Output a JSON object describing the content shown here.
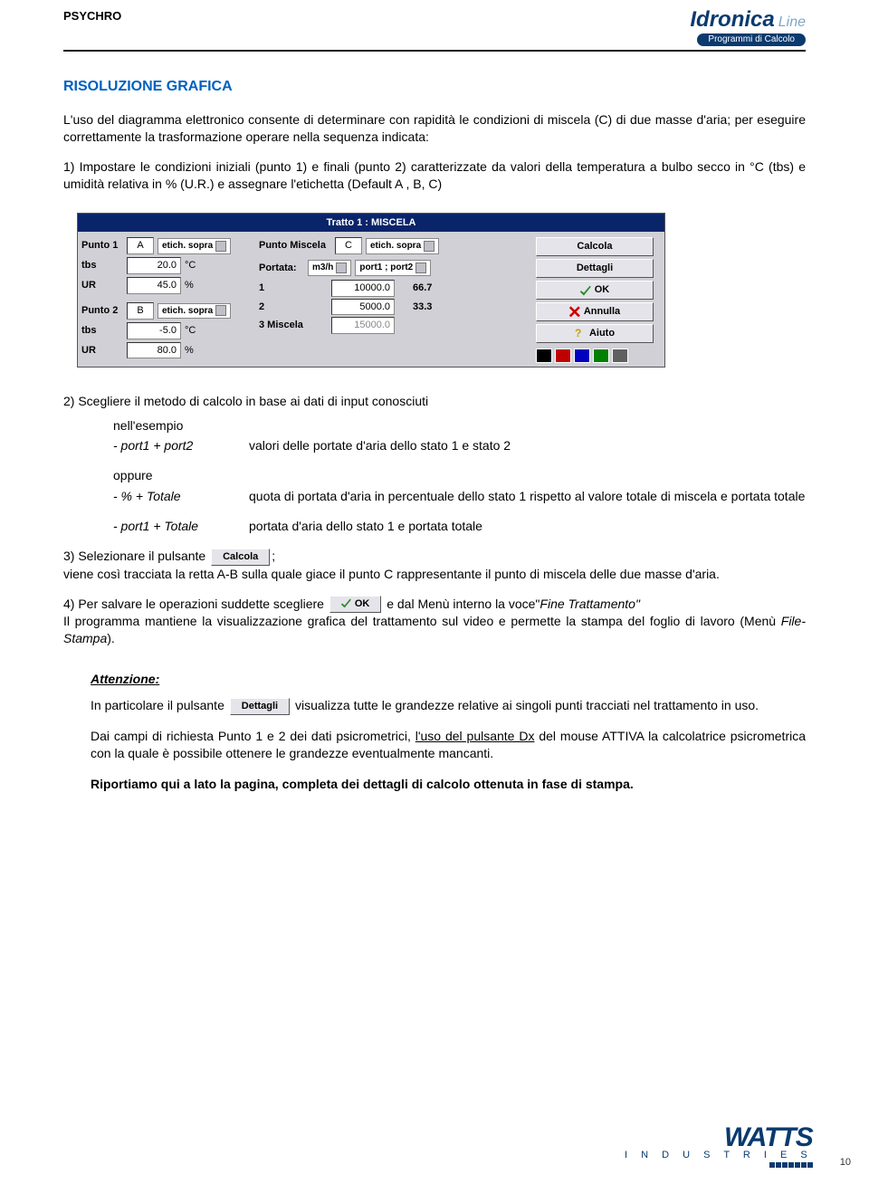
{
  "header": {
    "left": "PSYCHRO",
    "logo_main": "Idronica",
    "logo_sub": "Line",
    "logo_tag": "Programmi di Calcolo"
  },
  "title": "RISOLUZIONE GRAFICA",
  "intro": "L'uso del diagramma elettronico consente di determinare con rapidità le condizioni di miscela (C) di due masse d'aria; per eseguire correttamente la trasformazione operare nella sequenza indicata:",
  "step1": "1) Impostare le condizioni iniziali (punto 1) e finali (punto 2) caratterizzate da valori della temperatura a bulbo secco in °C (tbs) e umidità relativa in % (U.R.) e assegnare l'etichetta (Default A , B, C)",
  "panel": {
    "title": "Tratto  1 : MISCELA",
    "p1_label": "Punto 1",
    "p1_val": "A",
    "p1_dd": "etich. sopra",
    "tbs_label": "tbs",
    "p1_tbs": "20.0",
    "ur_label": "UR",
    "p1_ur": "45.0",
    "degc": "°C",
    "pct": "%",
    "p2_label": "Punto 2",
    "p2_val": "B",
    "p2_dd": "etich. sopra",
    "p2_tbs": "-5.0",
    "p2_ur": "80.0",
    "pm_label": "Punto Miscela",
    "pm_val": "C",
    "pm_dd": "etich. sopra",
    "portata_label": "Portata:",
    "portata_unit": "m3/h",
    "portata_basis": "port1    ; port2",
    "row1_n": "1",
    "row1_v": "10000.0",
    "row1_p": "66.7",
    "row2_n": "2",
    "row2_v": "5000.0",
    "row2_p": "33.3",
    "row3_n": "3 Miscela",
    "row3_v": "15000.0",
    "btn_calcola": "Calcola",
    "btn_dettagli": "Dettagli",
    "btn_ok": "OK",
    "btn_annulla": "Annulla",
    "btn_aiuto": "Aiuto"
  },
  "step2": "2) Scegliere il metodo di calcolo in base ai dati di input conosciuti",
  "ex": {
    "hdr": "nell'esempio",
    "a_l": "- port1 + port2",
    "a_r": "valori delle portate d'aria dello stato 1 e stato 2",
    "opp": "oppure",
    "b_l": "- % + Totale",
    "b_r": "quota di portata d'aria in percentuale dello stato 1 rispetto al valore totale di miscela e portata totale",
    "c_l": "- port1 + Totale",
    "c_r": "portata d'aria dello stato 1 e portata totale"
  },
  "step3_a": "3) Selezionare il pulsante ",
  "step3_b": ";",
  "step3_c": "viene così tracciata la retta A-B sulla quale giace il punto C rappresentante il punto di miscela delle due masse d'aria.",
  "step4_a": "4) Per salvare le operazioni suddette scegliere ",
  "step4_b": " e dal Menù interno la voce\"",
  "step4_c": "Fine Trattamento\"",
  "step4_d": "Il programma mantiene la visualizzazione grafica del trattamento sul video e permette la stampa del foglio di lavoro (Menù ",
  "step4_e": "File- Stampa",
  "step4_f": ").",
  "attn": "Attenzione",
  "att_a": "In particolare il pulsante ",
  "att_b": " visualizza tutte le grandezze relative ai singoli punti tracciati nel trattamento in uso.",
  "att2_a": "Dai campi di richiesta Punto 1 e 2 dei dati psicrometrici, ",
  "att2_u": "l'uso del pulsante Dx",
  "att2_b": " del mouse   ATTIVA   la calcolatrice psicrometrica con la quale è possibile ottenere le grandezze eventualmente mancanti.",
  "final": "Riportiamo qui a lato la pagina, completa dei dettagli di calcolo ottenuta in fase di stampa.",
  "inline_buttons": {
    "calcola": "Calcola",
    "ok": "OK",
    "dettagli": "Dettagli"
  },
  "footer": {
    "brand": "WATTS",
    "sub": "I N D U S T R I E S",
    "page": "10"
  }
}
